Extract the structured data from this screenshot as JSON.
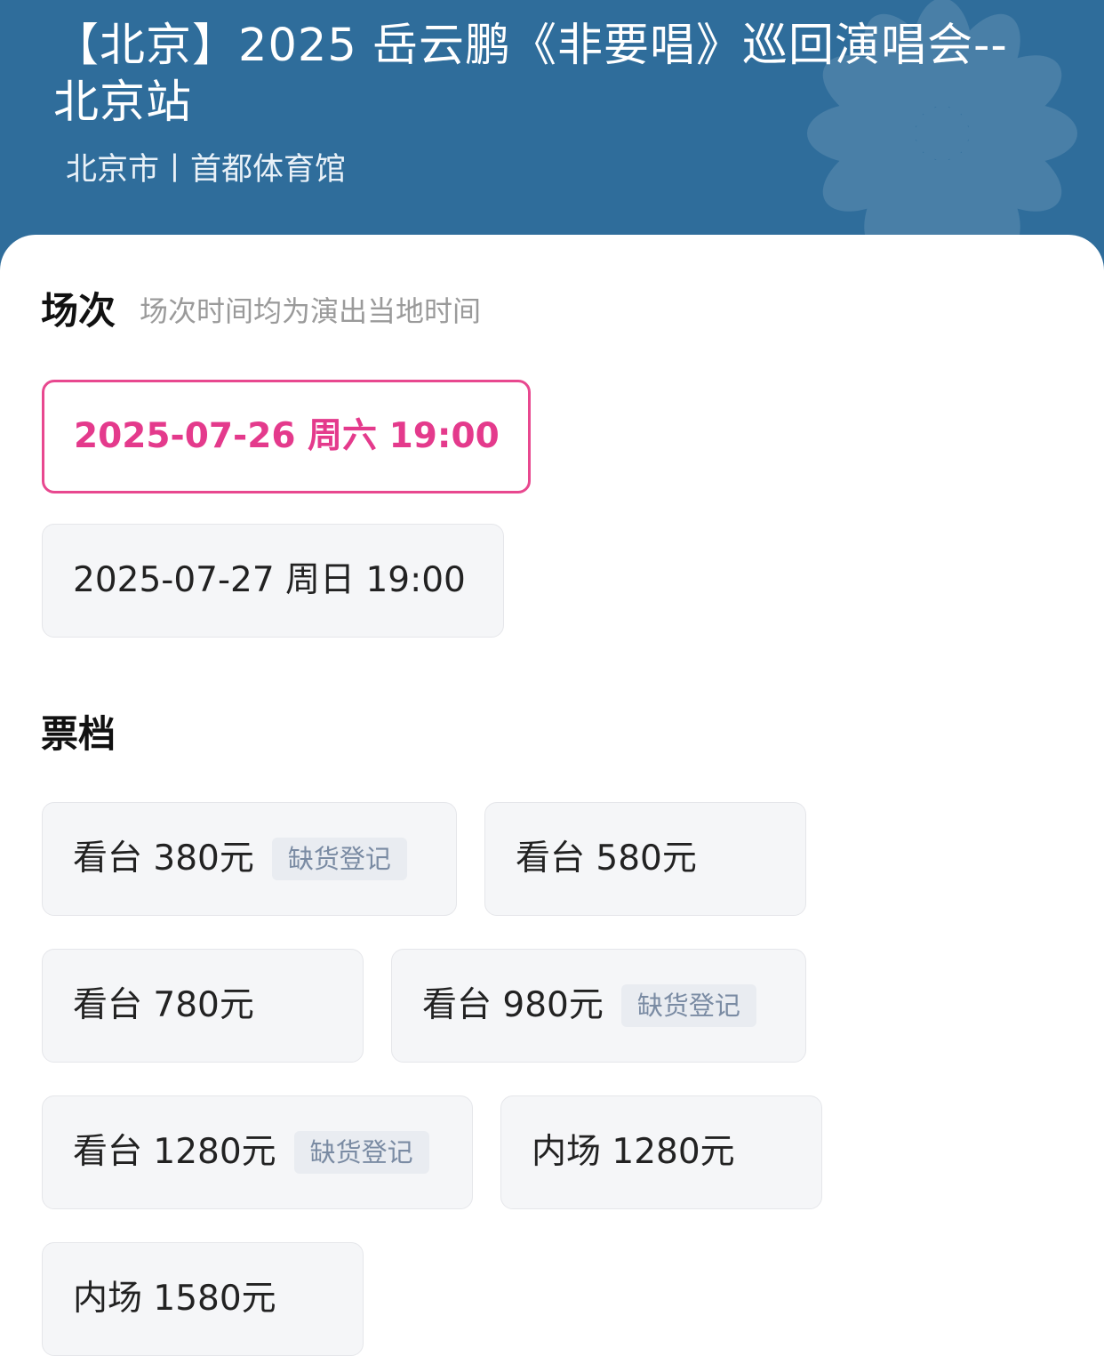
{
  "header": {
    "title": "【北京】2025 岳云鹏《非要唱》巡回演唱会--北京站",
    "location": "北京市丨首都体育馆"
  },
  "sessions": {
    "title": "场次",
    "note": "场次时间均为演出当地时间",
    "items": [
      {
        "label": "2025-07-26  周六 19:00",
        "selected": true
      },
      {
        "label": "2025-07-27 周日 19:00",
        "selected": false
      }
    ]
  },
  "tickets": {
    "title": "票档",
    "items": [
      {
        "label": "看台 380元",
        "badge": "缺货登记"
      },
      {
        "label": "看台 580元",
        "badge": ""
      },
      {
        "label": "看台 780元",
        "badge": ""
      },
      {
        "label": "看台 980元",
        "badge": "缺货登记"
      },
      {
        "label": "看台 1280元",
        "badge": "缺货登记"
      },
      {
        "label": "内场 1280元",
        "badge": ""
      },
      {
        "label": "内场 1580元",
        "badge": ""
      }
    ]
  },
  "colors": {
    "header_bg": "#2f6d9b",
    "accent": "#e8488f",
    "pill_bg": "#f5f6f8",
    "badge_bg": "#e9ecf1",
    "badge_text": "#7a8ba3"
  }
}
